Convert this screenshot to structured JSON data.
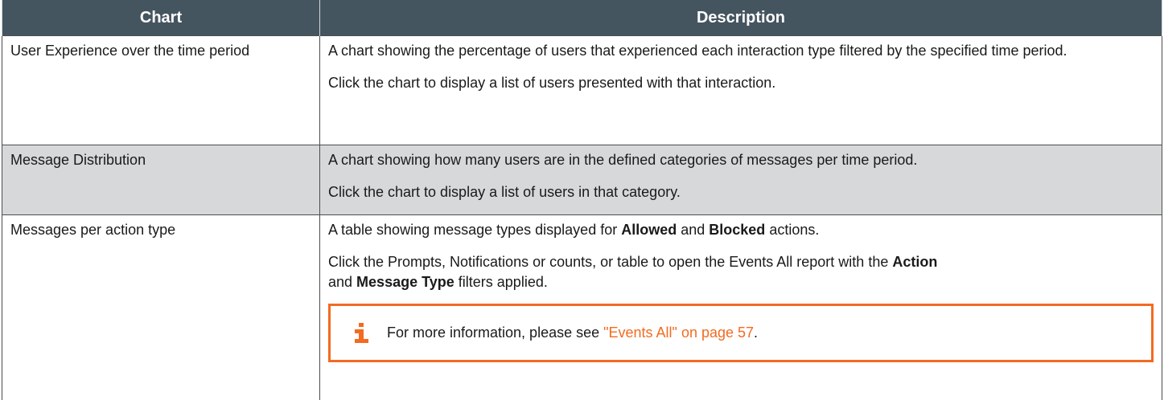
{
  "header": {
    "col1": "Chart",
    "col2": "Description"
  },
  "rows": [
    {
      "name": "User Experience over the time period",
      "desc": [
        "A chart showing the percentage of users that experienced each interaction type filtered by the specified time period.",
        "Click the chart to display a list of users presented with that interaction."
      ]
    },
    {
      "name": "Message Distribution",
      "desc": [
        "A chart showing how many users are in the defined categories of messages per time period.",
        "Click the chart to display a list of users in that category."
      ]
    },
    {
      "name": "Messages per action type",
      "p1": {
        "a": "A table showing message types displayed for ",
        "b1": "Allowed",
        "c": " and ",
        "b2": "Blocked",
        "d": " actions."
      },
      "p2": {
        "a": "Click the Prompts, Notifications or counts, or table to open the Events All report with the ",
        "b1": "Action",
        "c": " and ",
        "b2": "Message Type",
        "d": " filters applied."
      },
      "note": {
        "icon": "info-icon",
        "prefix": "For more information, please see ",
        "link": "\"Events All\" on page 57",
        "suffix": "."
      }
    }
  ],
  "colors": {
    "header_bg": "#455560",
    "shaded_row": "#d6d8d9",
    "accent": "#f26b21"
  }
}
